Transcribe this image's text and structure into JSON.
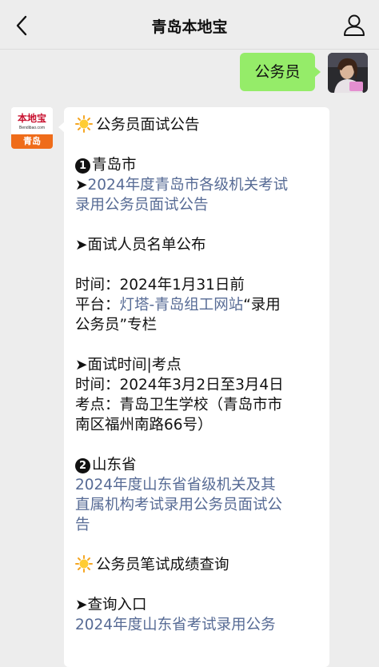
{
  "header": {
    "title": "青岛本地宝"
  },
  "sent_message": {
    "text": "公务员"
  },
  "bot": {
    "logo_text": "本地宝",
    "logo_url": "Bendibao.com",
    "logo_city": "青岛"
  },
  "message": {
    "section1_title": "公务员面试公告",
    "city_num": "1",
    "city_label": "青岛市",
    "arrow": "➤",
    "qd_link_l1": "2024年度青岛市各级机关考试",
    "qd_link_l2": "录用公务员面试公告",
    "list_heading": "➤面试人员名单公布",
    "time_line": "时间：2024年1月31日前",
    "platform_prefix": "平台：",
    "platform_link": "灯塔-青岛组工网站",
    "platform_suffix": "“录用",
    "platform_l2": "公务员”专栏",
    "interview_heading": "➤面试时间|考点",
    "interview_time": "时间：2024年3月2日至3月4日",
    "venue_l1": "考点：青岛卫生学校（青岛市市",
    "venue_l2": "南区福州南路66号）",
    "province_num": "2",
    "province_label": "山东省",
    "sd_link_l1": "2024年度山东省省级机关及其",
    "sd_link_l2": "直属机构考试录用公务员面试公",
    "sd_link_l3": "告",
    "section2_title": "公务员笔试成绩查询",
    "query_heading": "➤查询入口",
    "query_link_l1": "2024年度山东省考试录用公务"
  },
  "icons": {
    "back": "chevron-left-icon",
    "user": "user-icon",
    "sun": "sun-emoji-icon"
  },
  "colors": {
    "bubble_green": "#95ec69",
    "link_blue": "#576b95",
    "logo_orange": "#ef6c1a",
    "logo_red": "#c8102e"
  }
}
